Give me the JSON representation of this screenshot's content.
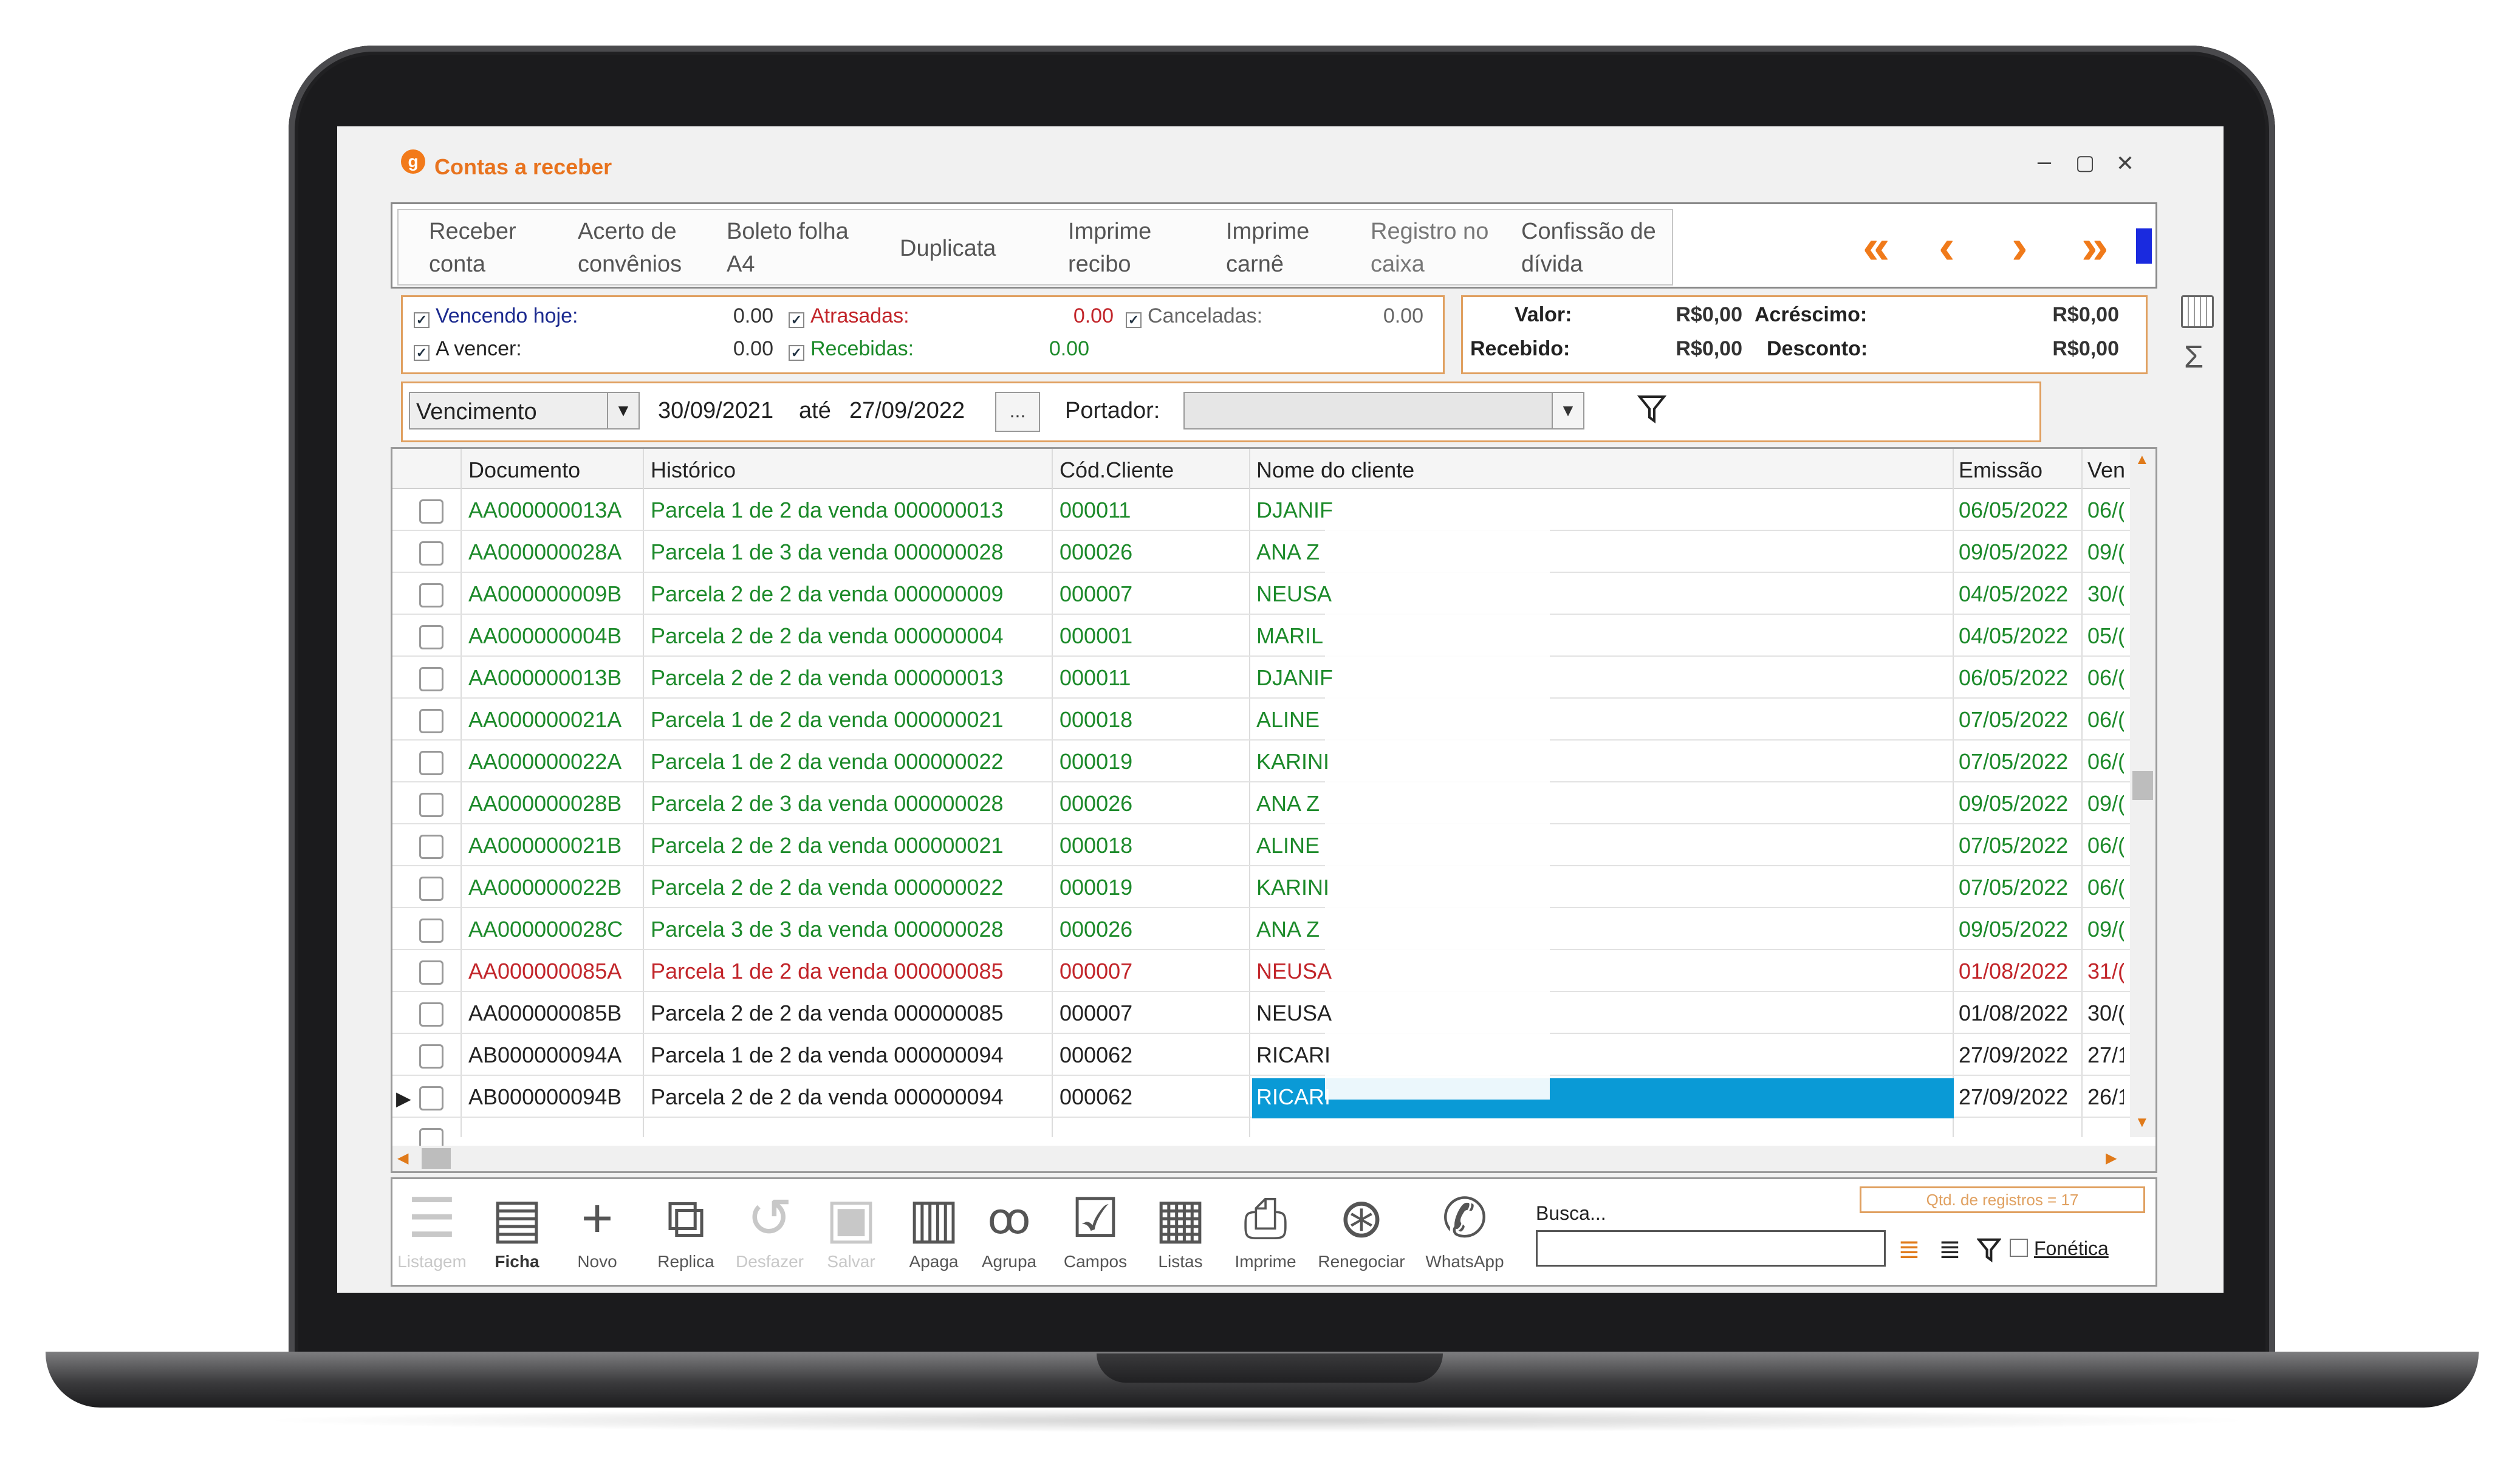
{
  "window": {
    "title": "Contas a receber",
    "logo_letter": "g",
    "minimize": "–",
    "maximize": "▢",
    "close": "✕"
  },
  "toolbar": {
    "buttons": [
      {
        "line1": "Receber",
        "line2": "conta"
      },
      {
        "line1": "Acerto de",
        "line2": "convênios"
      },
      {
        "line1": "Boleto folha",
        "line2": "A4"
      },
      {
        "line1": "Duplicata",
        "line2": ""
      },
      {
        "line1": "Imprime",
        "line2": "recibo"
      },
      {
        "line1": "Imprime",
        "line2": "carnê"
      },
      {
        "line1": "Registro no",
        "line2": "caixa"
      },
      {
        "line1": "Confissão de",
        "line2": "dívida"
      }
    ],
    "nav": {
      "first": "«",
      "prev": "‹",
      "next": "›",
      "last": "»"
    }
  },
  "filters": {
    "vencendo_hoje": {
      "label": "Vencendo hoje:",
      "value": "0.00",
      "checked": "✓"
    },
    "a_vencer": {
      "label": "A vencer:",
      "value": "0.00",
      "checked": "✓"
    },
    "atrasadas": {
      "label": "Atrasadas:",
      "value": "0.00",
      "checked": "✓"
    },
    "recebidas": {
      "label": "Recebidas:",
      "value": "0.00",
      "checked": "✓"
    },
    "canceladas": {
      "label": "Canceladas:",
      "value": "0.00",
      "checked": "✓"
    }
  },
  "totals": {
    "valor_label": "Valor:",
    "valor": "R$0,00",
    "acrescimo_label": "Acréscimo:",
    "acrescimo": "R$0,00",
    "recebido_label": "Recebido:",
    "recebido": "R$0,00",
    "desconto_label": "Desconto:",
    "desconto": "R$0,00"
  },
  "period": {
    "field": "Vencimento",
    "from": "30/09/2021",
    "ate": "até",
    "to": "27/09/2022",
    "ellipsis": "...",
    "portador_label": "Portador:",
    "portador_value": ""
  },
  "grid": {
    "headers": [
      "Documento",
      "Histórico",
      "Cód.Cliente",
      "Nome do cliente",
      "Emissão",
      "Ven"
    ],
    "rows": [
      {
        "doc": "AA000000013A",
        "hist": "Parcela 1 de 2 da venda 000000013",
        "cod": "000011",
        "nome": "DJANIF",
        "emissao": "06/05/2022",
        "venc": "06/(",
        "status": "green"
      },
      {
        "doc": "AA000000028A",
        "hist": "Parcela 1 de 3 da venda 000000028",
        "cod": "000026",
        "nome": "ANA Z",
        "emissao": "09/05/2022",
        "venc": "09/(",
        "status": "green"
      },
      {
        "doc": "AA000000009B",
        "hist": "Parcela 2 de 2 da venda 000000009",
        "cod": "000007",
        "nome": "NEUSA",
        "emissao": "04/05/2022",
        "venc": "30/(",
        "status": "green"
      },
      {
        "doc": "AA000000004B",
        "hist": "Parcela 2 de 2 da venda 000000004",
        "cod": "000001",
        "nome": "MARIL",
        "emissao": "04/05/2022",
        "venc": "05/(",
        "status": "green"
      },
      {
        "doc": "AA000000013B",
        "hist": "Parcela 2 de 2 da venda 000000013",
        "cod": "000011",
        "nome": "DJANIF",
        "emissao": "06/05/2022",
        "venc": "06/(",
        "status": "green"
      },
      {
        "doc": "AA000000021A",
        "hist": "Parcela 1 de 2 da venda 000000021",
        "cod": "000018",
        "nome": "ALINE",
        "emissao": "07/05/2022",
        "venc": "06/(",
        "status": "green"
      },
      {
        "doc": "AA000000022A",
        "hist": "Parcela 1 de 2 da venda 000000022",
        "cod": "000019",
        "nome": "KARINI",
        "emissao": "07/05/2022",
        "venc": "06/(",
        "status": "green"
      },
      {
        "doc": "AA000000028B",
        "hist": "Parcela 2 de 3 da venda 000000028",
        "cod": "000026",
        "nome": "ANA Z",
        "emissao": "09/05/2022",
        "venc": "09/(",
        "status": "green"
      },
      {
        "doc": "AA000000021B",
        "hist": "Parcela 2 de 2 da venda 000000021",
        "cod": "000018",
        "nome": "ALINE",
        "emissao": "07/05/2022",
        "venc": "06/(",
        "status": "green"
      },
      {
        "doc": "AA000000022B",
        "hist": "Parcela 2 de 2 da venda 000000022",
        "cod": "000019",
        "nome": "KARINI",
        "emissao": "07/05/2022",
        "venc": "06/(",
        "status": "green"
      },
      {
        "doc": "AA000000028C",
        "hist": "Parcela 3 de 3 da venda 000000028",
        "cod": "000026",
        "nome": "ANA Z",
        "emissao": "09/05/2022",
        "venc": "09/(",
        "status": "green"
      },
      {
        "doc": "AA000000085A",
        "hist": "Parcela 1 de 2 da venda 000000085",
        "cod": "000007",
        "nome": "NEUSA",
        "emissao": "01/08/2022",
        "venc": "31/(",
        "status": "red"
      },
      {
        "doc": "AA000000085B",
        "hist": "Parcela 2 de 2 da venda 000000085",
        "cod": "000007",
        "nome": "NEUSA",
        "emissao": "01/08/2022",
        "venc": "30/(",
        "status": "black"
      },
      {
        "doc": "AB000000094A",
        "hist": "Parcela 1 de 2 da venda 000000094",
        "cod": "000062",
        "nome": "RICARI",
        "emissao": "27/09/2022",
        "venc": "27/1",
        "status": "black"
      },
      {
        "doc": "AB000000094B",
        "hist": "Parcela 2 de 2 da venda 000000094",
        "cod": "000062",
        "nome": "RICARI",
        "emissao": "27/09/2022",
        "venc": "26/1",
        "status": "black"
      }
    ]
  },
  "bottom": {
    "buttons": [
      "Listagem",
      "Ficha",
      "Novo",
      "Replica",
      "Desfazer",
      "Salvar",
      "Apaga",
      "Agrupa",
      "Campos",
      "Listas",
      "Imprime",
      "Renegociar",
      "WhatsApp"
    ],
    "busca_label": "Busca...",
    "qtd": "Qtd. de registros = 17",
    "fonetica": "Fonética"
  },
  "colors": {
    "accent": "#f07a1a",
    "selection": "#0a9ad6",
    "green": "#1c8a2a",
    "red": "#c2252a"
  }
}
